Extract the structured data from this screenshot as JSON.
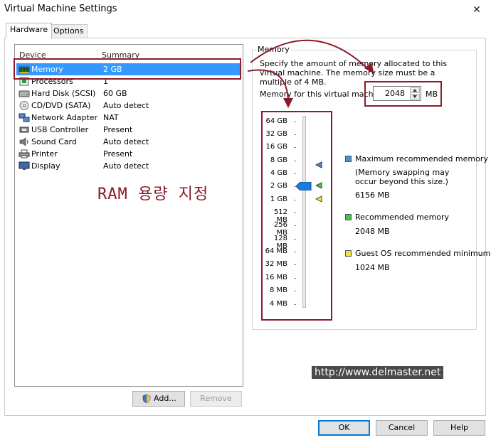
{
  "window": {
    "title": "Virtual Machine Settings",
    "close": "✕"
  },
  "tabs": [
    {
      "label": "Hardware"
    },
    {
      "label": "Options"
    }
  ],
  "device_list": {
    "header_device": "Device",
    "header_summary": "Summary",
    "devices": [
      {
        "name": "Memory",
        "summary": "2 GB",
        "icon": "memory-icon"
      },
      {
        "name": "Processors",
        "summary": "1",
        "icon": "processor-icon"
      },
      {
        "name": "Hard Disk (SCSI)",
        "summary": "60 GB",
        "icon": "hard-disk-icon"
      },
      {
        "name": "CD/DVD (SATA)",
        "summary": "Auto detect",
        "icon": "cd-dvd-icon"
      },
      {
        "name": "Network Adapter",
        "summary": "NAT",
        "icon": "network-adapter-icon"
      },
      {
        "name": "USB Controller",
        "summary": "Present",
        "icon": "usb-icon"
      },
      {
        "name": "Sound Card",
        "summary": "Auto detect",
        "icon": "sound-card-icon"
      },
      {
        "name": "Printer",
        "summary": "Present",
        "icon": "printer-icon"
      },
      {
        "name": "Display",
        "summary": "Auto detect",
        "icon": "display-icon"
      }
    ]
  },
  "buttons": {
    "add": "Add...",
    "remove": "Remove",
    "ok": "OK",
    "cancel": "Cancel",
    "help": "Help"
  },
  "memory": {
    "group_label": "Memory",
    "description": "Specify the amount of memory allocated to this virtual machine. The memory size must be a multiple of 4 MB.",
    "field_label": "Memory for this virtual machine:",
    "value": "2048",
    "unit": "MB",
    "scale": [
      "64 GB",
      "32 GB",
      "16 GB",
      "8 GB",
      "4 GB",
      "2 GB",
      "1 GB",
      "512 MB",
      "256 MB",
      "128 MB",
      "64 MB",
      "32 MB",
      "16 MB",
      "8 MB",
      "4 MB"
    ],
    "legend": {
      "max_title": "Maximum recommended memory",
      "max_note": "(Memory swapping may occur beyond this size.)",
      "max_value": "6156 MB",
      "rec_title": "Recommended memory",
      "rec_value": "2048 MB",
      "guest_title": "Guest OS recommended minimum",
      "guest_value": "1024 MB"
    },
    "colors": {
      "max": "#4a8fd4",
      "recommended": "#4cbf4c",
      "guest_min": "#f0e040"
    }
  },
  "annotation": {
    "text": "RAM 용량 지정",
    "color": "#8b1a2b"
  },
  "watermark": "http://www.delmaster.net"
}
